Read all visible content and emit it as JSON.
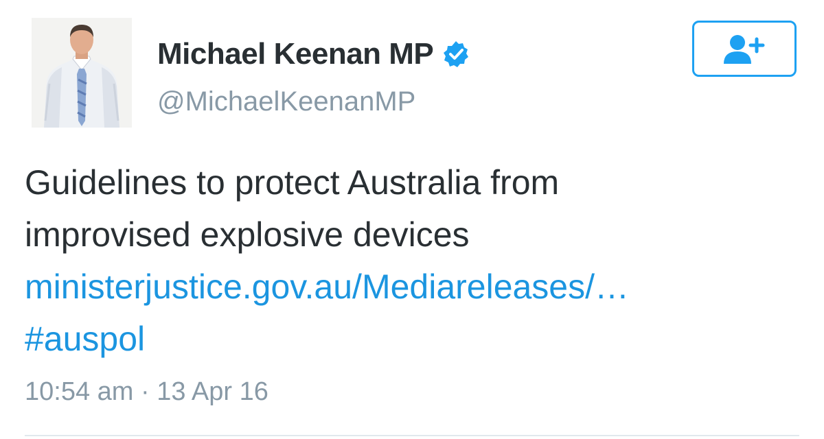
{
  "tweet": {
    "author": {
      "display_name": "Michael Keenan MP",
      "handle": "@MichaelKeenanMP",
      "verified": true,
      "avatar_icon": "profile-photo"
    },
    "follow_button": {
      "icon": "add-user-icon"
    },
    "text_line_1": "Guidelines to protect Australia from",
    "text_line_2": "improvised explosive devices",
    "link": "ministerjustice.gov.au/Mediareleases/…",
    "hashtag": "#auspol",
    "timestamp": "10:54 am · 13 Apr 16"
  },
  "colors": {
    "text": "#292f33",
    "secondary": "#8899a6",
    "link": "#1b95e0",
    "accent": "#1da1f2",
    "divider": "#e1e8ed"
  }
}
